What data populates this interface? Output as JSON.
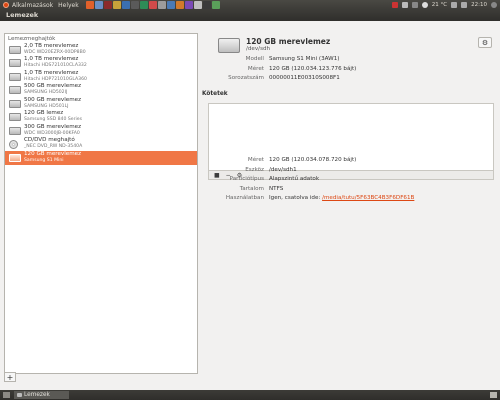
{
  "top_panel": {
    "menus": [
      "Alkalmazások",
      "Helyek"
    ],
    "weather": "21 °C",
    "clock": "22:10"
  },
  "window": {
    "title": "Lemezek"
  },
  "left_pane": {
    "header": "Lemezmeghajtók",
    "devices": [
      {
        "title": "2,0 TB merevlemez",
        "sub": "WDC WD20EZRX-00DP8B0",
        "type": "hdd",
        "selected": false
      },
      {
        "title": "1,0 TB merevlemez",
        "sub": "Hitachi HDS721010CLA332",
        "type": "hdd",
        "selected": false
      },
      {
        "title": "1,0 TB merevlemez",
        "sub": "Hitachi HDP721010GLA360",
        "type": "hdd",
        "selected": false
      },
      {
        "title": "500 GB merevlemez",
        "sub": "SAMSUNG HD502IJ",
        "type": "hdd",
        "selected": false
      },
      {
        "title": "500 GB merevlemez",
        "sub": "SAMSUNG HD501LJ",
        "type": "hdd",
        "selected": false
      },
      {
        "title": "120 GB lemez",
        "sub": "Samsung SSD 840 Series",
        "type": "hdd",
        "selected": false
      },
      {
        "title": "300 GB merevlemez",
        "sub": "WDC WD3000JB-00KFA0",
        "type": "hdd",
        "selected": false
      },
      {
        "title": "CD/DVD meghajtó",
        "sub": "_NEC DVD_RW ND-3540A",
        "type": "disc",
        "selected": false
      },
      {
        "title": "120 GB merevlemez",
        "sub": "Samsung S1 Mini",
        "type": "hdd",
        "selected": true
      }
    ],
    "add_label": "+"
  },
  "right_pane": {
    "title": "120 GB merevlemez",
    "subtitle": "/dev/sdh",
    "gear_label": "⚙",
    "info": [
      {
        "key": "Modell",
        "value": "Samsung S1 Mini (3AW1)"
      },
      {
        "key": "Méret",
        "value": "120 GB (120.034.123.776 bájt)"
      },
      {
        "key": "Sorozatszám",
        "value": "00000011E00310S008F1"
      }
    ],
    "volumes_header": "Kötetek",
    "volume_tools": [
      "■",
      "−",
      "⚙"
    ],
    "volume_info": [
      {
        "key": "Méret",
        "value": "120 GB (120.034.078.720 bájt)"
      },
      {
        "key": "Eszköz",
        "value": "/dev/sdh1"
      },
      {
        "key": "Partíciótípus",
        "value": "Alapszintű adatok"
      },
      {
        "key": "Tartalom",
        "value": "NTFS"
      },
      {
        "key": "Használatban",
        "value": "Igen, csatolva ide:",
        "link": "/media/tutu/5F63BC4B3F6DF61B"
      }
    ]
  },
  "bottom_panel": {
    "task_label": "Lemezek"
  },
  "colors": {
    "accent": "#f07746",
    "panel": "#3c3b37",
    "link": "#dd4814"
  }
}
